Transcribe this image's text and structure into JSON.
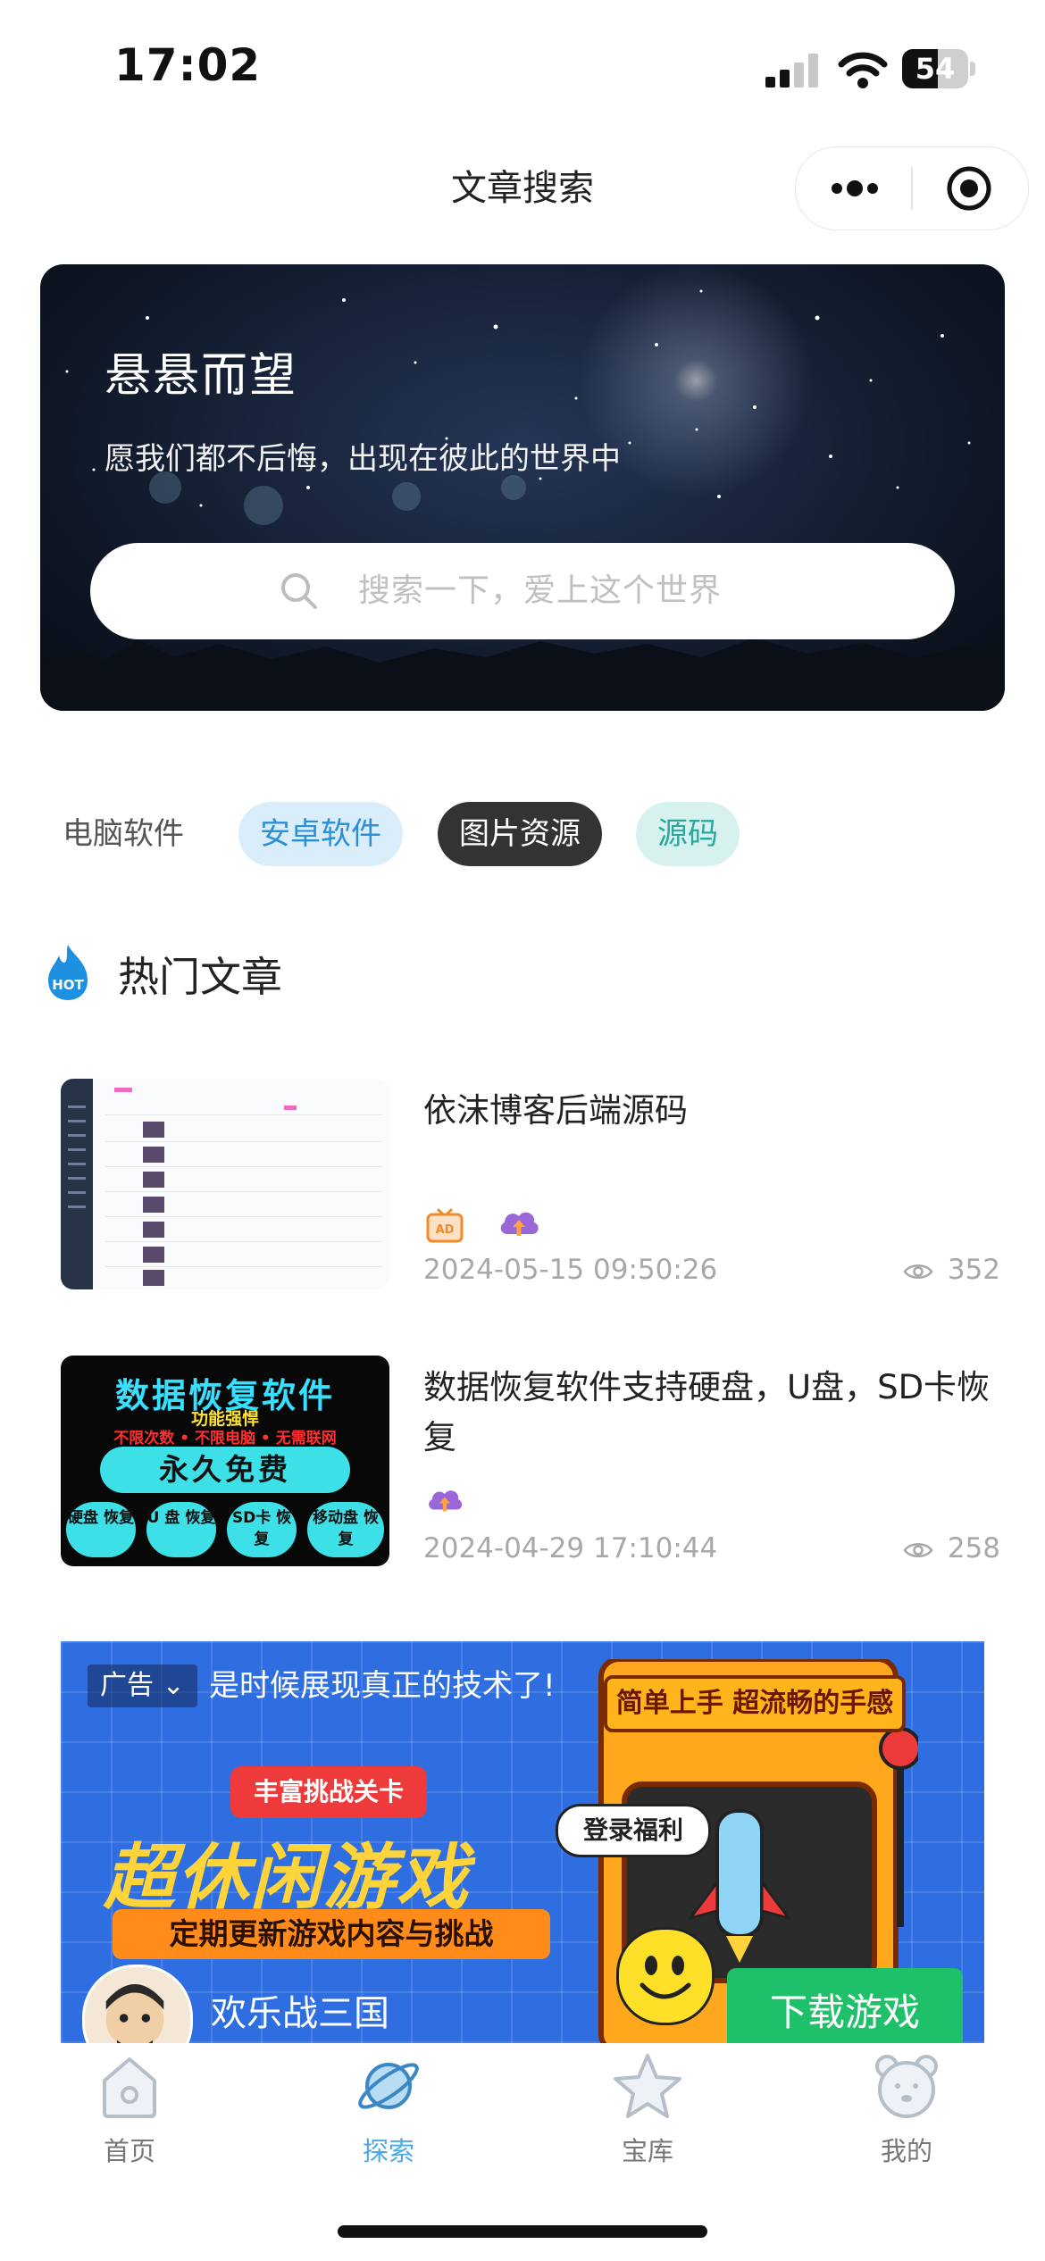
{
  "status_bar": {
    "time": "17:02",
    "battery": "54",
    "battery_level": 0.54
  },
  "nav": {
    "title": "文章搜索"
  },
  "hero": {
    "title": "悬悬而望",
    "subtitle": "愿我们都不后悔，出现在彼此的世界中",
    "search_placeholder": "搜索一下，爱上这个世界"
  },
  "categories": [
    "电脑软件",
    "安卓软件",
    "图片资源",
    "源码"
  ],
  "section": {
    "title": "热门文章",
    "hot_badge": "HOT"
  },
  "articles": [
    {
      "title": "依沫博客后端源码",
      "date": "2024-05-15 09:50:26",
      "views": "352",
      "tags": [
        "ad-tv-icon",
        "cloud-upload-icon"
      ]
    },
    {
      "title": "数据恢复软件支持硬盘，U盘，SD卡恢复",
      "date": "2024-04-29 17:10:44",
      "views": "258",
      "tags": [
        "cloud-upload-icon"
      ],
      "thumb": {
        "headline": "数据恢复软件",
        "strong": "功能强悍",
        "features": "不限次数 • 不限电脑 • 无需联网",
        "pill": "永久免费",
        "circles": [
          "硬盘 恢复",
          "U 盘 恢复",
          "SD卡 恢复",
          "移动盘 恢复"
        ]
      }
    }
  ],
  "ad": {
    "tag": "广告",
    "headline": "是时候展现真正的技术了!",
    "banner_title": "简单上手 超流畅的手感",
    "feature_tag": "丰富挑战关卡",
    "big_text": "超休闲游戏",
    "sub_text": "定期更新游戏内容与挑战",
    "login_bonus": "登录福利",
    "app_name": "欢乐战三国",
    "cta": "下载游戏"
  },
  "tabs": [
    {
      "label": "首页",
      "active": false
    },
    {
      "label": "探索",
      "active": true
    },
    {
      "label": "宝库",
      "active": false
    },
    {
      "label": "我的",
      "active": false
    }
  ],
  "colors": {
    "accent": "#4aa8e8",
    "chip_blue": "#d9edfb",
    "chip_dark": "#333333",
    "chip_teal": "#d6f1ee",
    "hot": "#1f8fe0"
  }
}
